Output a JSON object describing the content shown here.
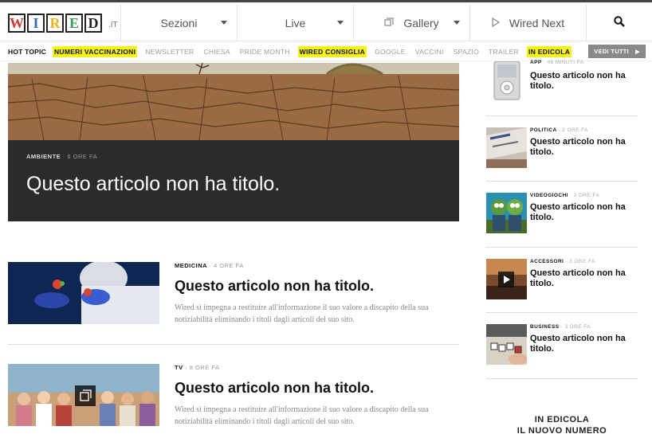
{
  "brand": {
    "letters": [
      "W",
      "I",
      "R",
      "E",
      "D"
    ],
    "colors": [
      "#d43a2f",
      "#2c6fb7",
      "#e8b21a",
      "#3a9d52",
      "#222222"
    ],
    "suffix": ".IT"
  },
  "nav": {
    "sezioni": "Sezioni",
    "live": "Live",
    "gallery": "Gallery",
    "wired_next": "Wired Next",
    "search_icon": "search-icon"
  },
  "hot_topic": {
    "label": "HOT TOPIC",
    "topics": [
      "NUMERI VACCINAZIONI",
      "NEWSLETTER",
      "CHIESA",
      "PRIDE MONTH",
      "WIRED CONSIGLIA",
      "GOOGLE",
      "VACCINI",
      "SPAZIO",
      "TRAILER",
      "IN EDICOLA"
    ],
    "highlighted": [
      "NUMERI VACCINAZIONI",
      "WIRED CONSIGLIA",
      "IN EDICOLA"
    ],
    "vedi_tutti": "VEDI TUTTI"
  },
  "hero": {
    "category": "AMBIENTE",
    "time": "6 ORE FA",
    "title": "Questo articolo non ha titolo."
  },
  "articles": [
    {
      "category": "MEDICINA",
      "time": "4 ORE FA",
      "title": "Questo articolo non ha titolo.",
      "description": "Wired si impegna a restituire all'informazione il suo valore a discapito della sua notiziabilità eliminando i titoli dagli articoli del suo sito."
    },
    {
      "category": "TV",
      "time": "8 ORE FA",
      "title": "Questo articolo non ha titolo.",
      "description": "Wired si impegna a restituire all'informazione il suo valore a discapito della sua notiziabilità eliminando i titoli dagli articoli del suo sito."
    }
  ],
  "sidebar": [
    {
      "category": "APP",
      "time": "48 MINUTI FA",
      "title": "Questo articolo non ha titolo."
    },
    {
      "category": "POLITICA",
      "time": "2 ORE FA",
      "title": "Questo articolo non ha titolo."
    },
    {
      "category": "VIDEOGIOCHI",
      "time": "3 ORE FA",
      "title": "Questo articolo non ha titolo."
    },
    {
      "category": "ACCESSORI",
      "time": "3 ORE FA",
      "title": "Questo articolo non ha titolo."
    },
    {
      "category": "BUSINESS",
      "time": "3 ORE FA",
      "title": "Questo articolo non ha titolo."
    }
  ],
  "edicola": {
    "line1": "IN EDICOLA",
    "line2": "IL NUOVO NUMERO"
  }
}
